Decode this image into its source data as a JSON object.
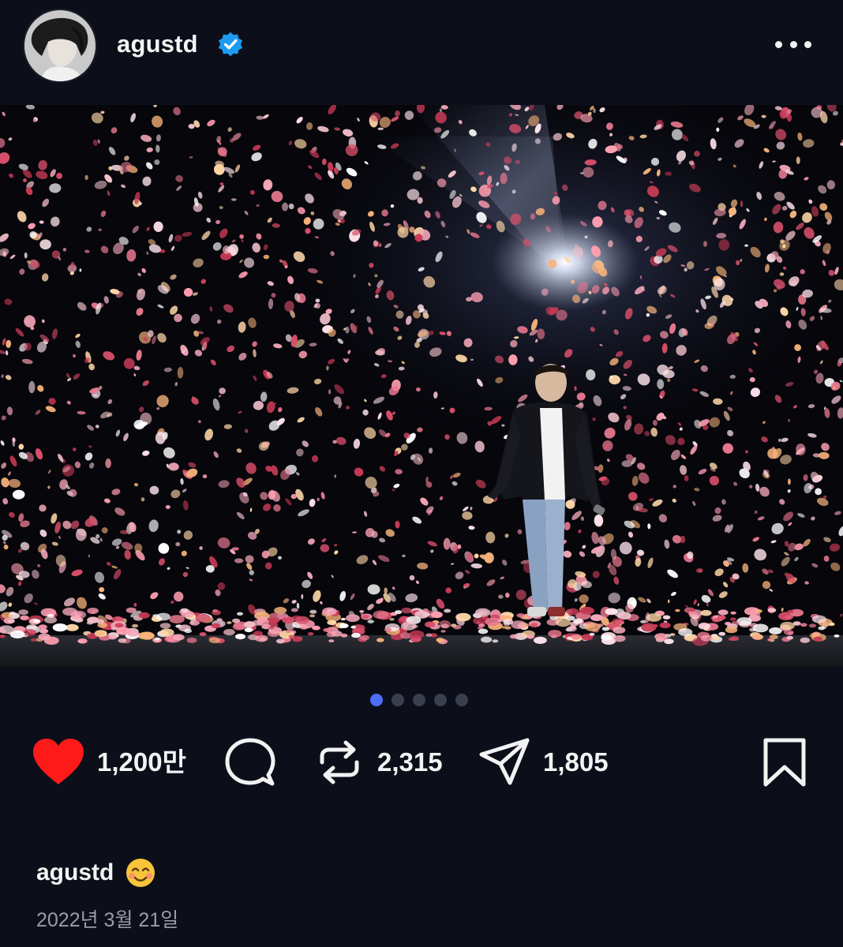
{
  "header": {
    "username": "agustd",
    "verified": true,
    "avatar_icon": "profile-photo",
    "more_icon": "more-horizontal-icon"
  },
  "post": {
    "image_icon": "concert-photo",
    "carousel": {
      "total": 5,
      "active_index": 0,
      "active_color": "#4c6ef5",
      "inactive_color": "#3a3f4e"
    }
  },
  "actions": {
    "like_count": "1,200만",
    "repost_count": "2,315",
    "share_count": "1,805",
    "like_color": "#ff1a1a"
  },
  "caption": {
    "username": "agustd",
    "emoji": "☺️"
  },
  "date": "2022년 3월 21일",
  "colors": {
    "background": "#0c0f1a",
    "text": "#f5f5f5",
    "muted": "#9a9da6",
    "verified_blue": "#1d9bf0"
  }
}
